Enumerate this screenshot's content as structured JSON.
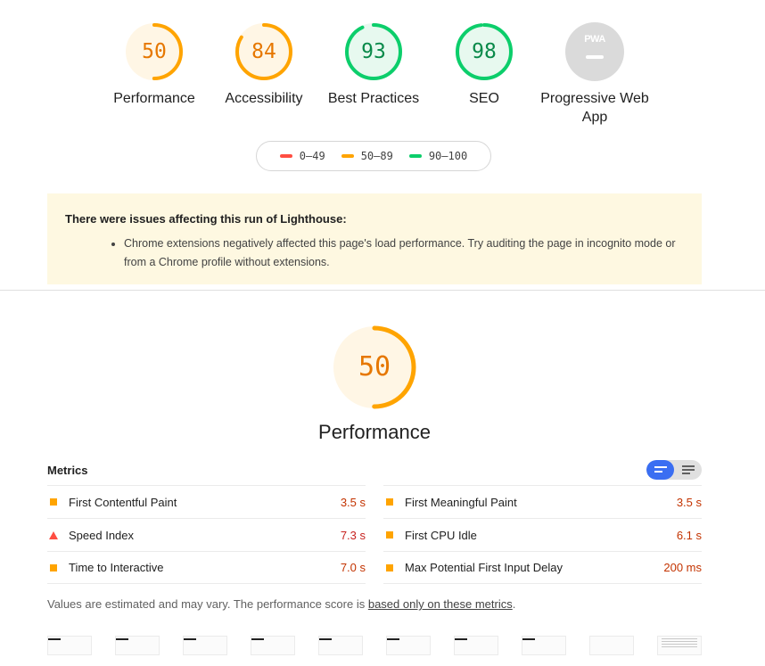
{
  "gauges": [
    {
      "score": "50",
      "label": "Performance",
      "fraction": 0.5,
      "color": "#ffa400",
      "bg": "#fff6e5"
    },
    {
      "score": "84",
      "label": "Accessibility",
      "fraction": 0.84,
      "color": "#ffa400",
      "bg": "#fff6e5"
    },
    {
      "score": "93",
      "label": "Best Practices",
      "fraction": 0.93,
      "color": "#0cce6b",
      "bg": "#e7f9ef"
    },
    {
      "score": "98",
      "label": "SEO",
      "fraction": 0.98,
      "color": "#0cce6b",
      "bg": "#e7f9ef"
    }
  ],
  "pwa": {
    "badge": "PWA",
    "label": "Progressive Web App",
    "color": "#dadada"
  },
  "legend": [
    {
      "range": "0–49",
      "color": "#ff4e42"
    },
    {
      "range": "50–89",
      "color": "#ffa400"
    },
    {
      "range": "90–100",
      "color": "#0cce6b"
    }
  ],
  "warning": {
    "title": "There were issues affecting this run of Lighthouse:",
    "items": [
      "Chrome extensions negatively affected this page's load performance. Try auditing the page in incognito mode or from a Chrome profile without extensions."
    ]
  },
  "performance": {
    "score": "50",
    "fraction": 0.5,
    "title": "Performance"
  },
  "metrics": {
    "header": "Metrics",
    "left": [
      {
        "name": "First Contentful Paint",
        "value": "3.5 s",
        "status": "average",
        "value_color": "#c33300"
      },
      {
        "name": "Speed Index",
        "value": "7.3 s",
        "status": "fail",
        "value_color": "#c7221f"
      },
      {
        "name": "Time to Interactive",
        "value": "7.0 s",
        "status": "average",
        "value_color": "#c33300"
      }
    ],
    "right": [
      {
        "name": "First Meaningful Paint",
        "value": "3.5 s",
        "status": "average",
        "value_color": "#c33300"
      },
      {
        "name": "First CPU Idle",
        "value": "6.1 s",
        "status": "average",
        "value_color": "#c33300"
      },
      {
        "name": "Max Potential First Input Delay",
        "value": "200 ms",
        "status": "average",
        "value_color": "#c33300"
      }
    ]
  },
  "footnote": {
    "prefix": "Values are estimated and may vary. The performance score is ",
    "link": "based only on these metrics",
    "suffix": "."
  },
  "toggle_icons": [
    "metric-description-toggle-icon",
    "list-view-icon"
  ]
}
